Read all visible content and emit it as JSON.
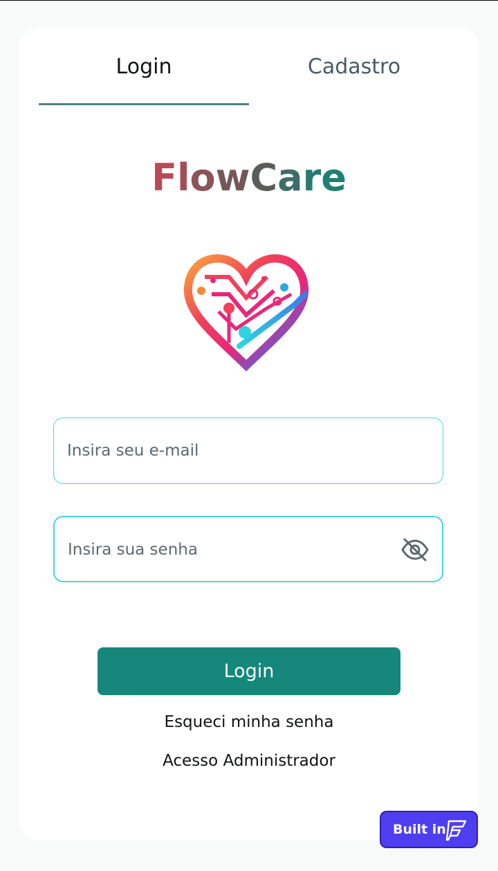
{
  "tabs": [
    {
      "label": "Login",
      "active": true
    },
    {
      "label": "Cadastro",
      "active": false
    }
  ],
  "brand": {
    "name": "FlowCare",
    "letters": [
      "F",
      "l",
      "o",
      "w",
      "C",
      "a",
      "r",
      "e"
    ],
    "gradient": [
      "#b84a58",
      "#a04f5b",
      "#8c5358",
      "#735857",
      "#5a5e5a",
      "#3d6d65",
      "#267a70",
      "#1f8072"
    ]
  },
  "logo": {
    "icon": "circuit-heart-logo"
  },
  "form": {
    "email_placeholder": "Insira seu e-mail",
    "password_placeholder": "Insira sua senha",
    "password_toggle_icon": "eye-off-icon",
    "login_label": "Login"
  },
  "links": {
    "forgot_password": "Esqueci minha senha",
    "admin_access": "Acesso Administrador"
  },
  "badge": {
    "label": "Built in",
    "icon": "flutterflow-logo-icon"
  },
  "colors": {
    "accent": "#15877b",
    "field_border": "#44d7df",
    "tab_indicator": "#4f7f8c",
    "badge": "#4f3ef0"
  }
}
